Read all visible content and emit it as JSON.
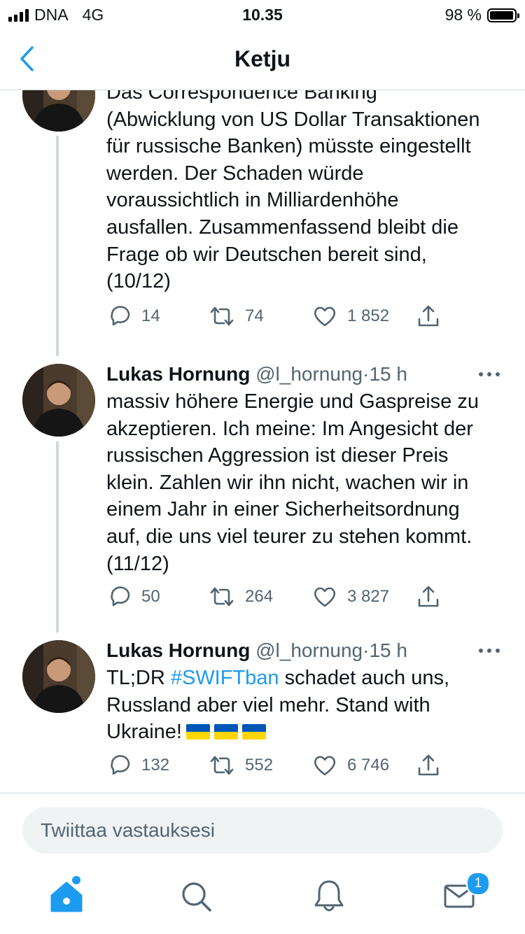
{
  "status_bar": {
    "carrier": "DNA",
    "network": "4G",
    "time": "10.35",
    "battery": "98 %",
    "battery_level": 0.98
  },
  "nav": {
    "title": "Ketju"
  },
  "tweets": [
    {
      "name": "",
      "handle": "",
      "time": "",
      "lines": [
        "Das Correspondence Banking",
        "(Abwicklung von US Dollar Transaktionen",
        "für russische Banken) müsste eingestellt",
        "werden. Der Schaden würde",
        "voraussichtlich in Milliardenhöhe",
        "ausfallen. Zusammenfassend bleibt die",
        "Frage ob wir Deutschen bereit sind,",
        "(10/12)"
      ],
      "replies": "14",
      "retweets": "74",
      "likes": "1 852"
    },
    {
      "name": "Lukas Hornung",
      "handle": "@l_hornung",
      "dot": "·",
      "time": "15 h",
      "lines": [
        "massiv höhere Energie und Gaspreise zu",
        "akzeptieren. Ich meine: Im Angesicht der",
        "russischen Aggression ist dieser Preis",
        "klein. Zahlen wir ihn nicht, wachen wir in",
        "einem Jahr in einer Sicherheitsordnung",
        "auf, die uns viel teurer zu stehen kommt.",
        "(11/12)"
      ],
      "replies": "50",
      "retweets": "264",
      "likes": "3 827"
    },
    {
      "name": "Lukas Hornung",
      "handle": "@l_hornung",
      "dot": "·",
      "time": "15 h",
      "line1_prefix": "TL;DR ",
      "hashtag": "#SWIFTban",
      "line1_suffix": " schadet auch uns,",
      "line2": "Russland aber viel mehr. Stand with",
      "line3": "Ukraine!",
      "replies": "132",
      "retweets": "552",
      "likes": "6 746"
    }
  ],
  "reply_bar": {
    "placeholder": "Twiittaa vastauksesi"
  },
  "tab_bar": {
    "messages_badge": "1"
  },
  "colors": {
    "accent": "#1d9bf0",
    "text": "#0f1419",
    "secondary": "#536471",
    "divider": "#cfd9de",
    "flag_blue": "#0057b7",
    "flag_yellow": "#ffd700"
  },
  "icons": [
    "back-icon",
    "more-icon",
    "reply-icon",
    "retweet-icon",
    "like-icon",
    "share-icon",
    "home-icon",
    "search-icon",
    "notifications-icon",
    "messages-icon"
  ]
}
